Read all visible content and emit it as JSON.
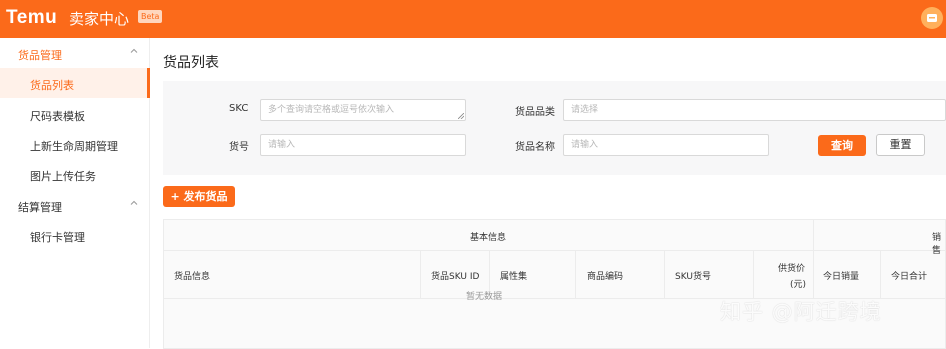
{
  "header": {
    "logo": "Temu",
    "subtitle": "卖家中心",
    "badge": "Beta",
    "accent_color": "#fb6a1a",
    "avatar_icon": "store-icon"
  },
  "sidebar": {
    "groups": [
      {
        "label": "货品管理",
        "expanded": true
      },
      {
        "label": "结算管理",
        "expanded": true
      }
    ],
    "items": [
      {
        "label": "货品列表",
        "active": true
      },
      {
        "label": "尺码表模板"
      },
      {
        "label": "上新生命周期管理"
      },
      {
        "label": "图片上传任务"
      },
      {
        "label": "银行卡管理"
      }
    ]
  },
  "main": {
    "title": "货品列表",
    "filters": {
      "skc": {
        "label": "SKC",
        "placeholder": "多个查询请空格或逗号依次输入"
      },
      "category": {
        "label": "货品品类",
        "placeholder": "请选择"
      },
      "item_no": {
        "label": "货号",
        "placeholder": "请输入"
      },
      "name": {
        "label": "货品名称",
        "placeholder": "请输入"
      },
      "search_button": "查询",
      "reset_button": "重置"
    },
    "publish_button": "+ 发布货品",
    "table": {
      "group_headers": [
        "基本信息",
        "销售"
      ],
      "columns": [
        "货品信息",
        "货品SKU ID",
        "属性集",
        "商品编码",
        "SKU货号",
        "供货价",
        "(元)",
        "今日销量",
        "今日合计"
      ],
      "empty_text": "暂无数据"
    }
  },
  "watermark": "知乎 @阿迁跨境"
}
